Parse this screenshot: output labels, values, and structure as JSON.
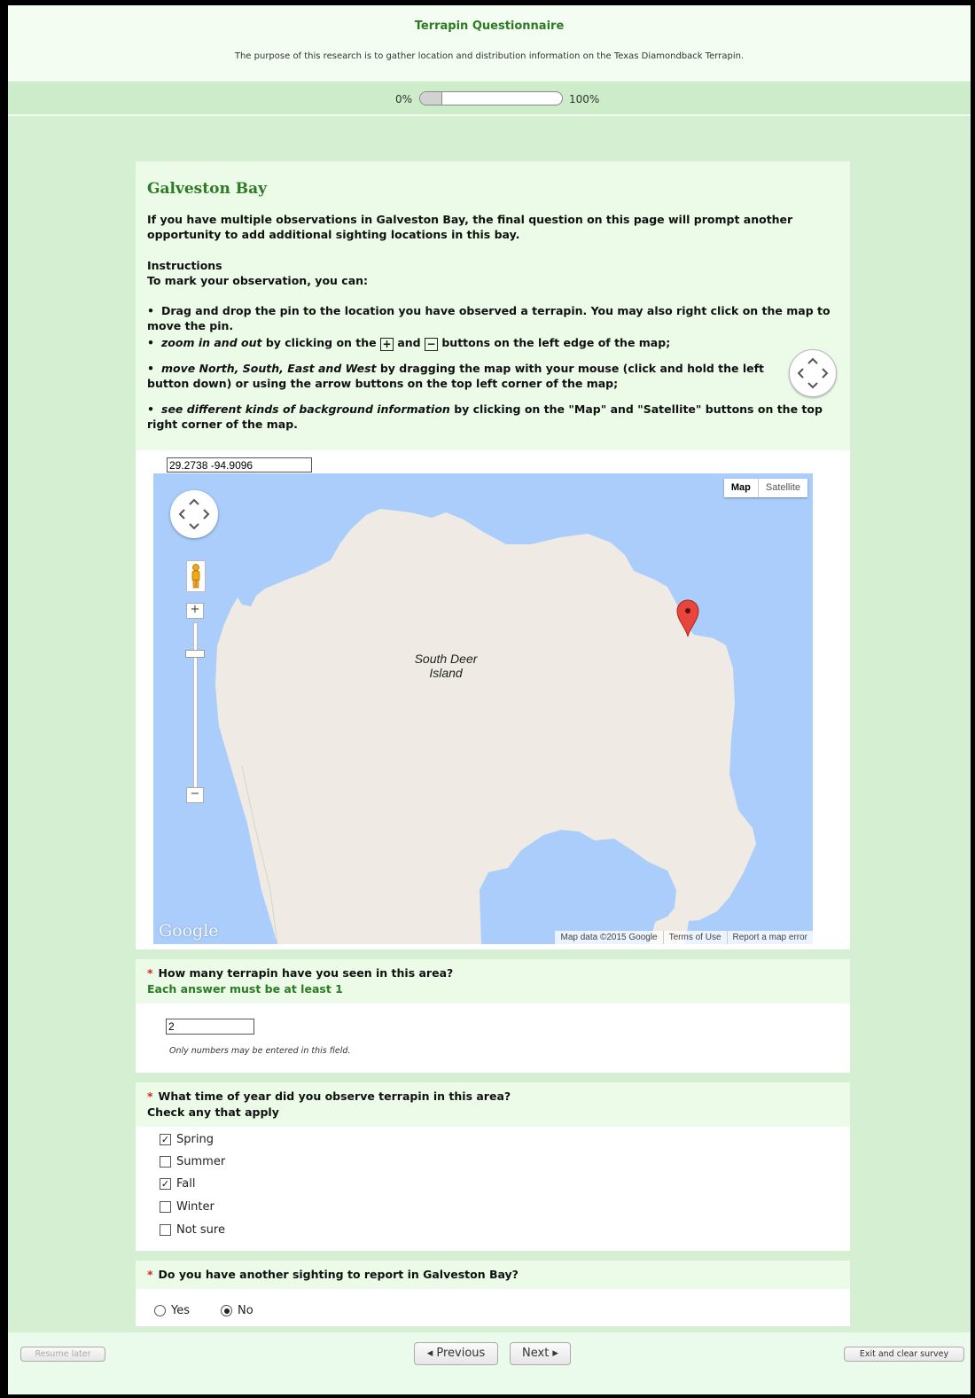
{
  "header": {
    "title": "Terrapin Questionnaire",
    "description": "The purpose of this research is to gather location and distribution information on the Texas Diamondback Terrapin."
  },
  "progress": {
    "min_label": "0%",
    "max_label": "100%",
    "value_fraction": 0.15
  },
  "section": {
    "title": "Galveston Bay",
    "intro": "If you have multiple observations in Galveston Bay, the final question on this page will prompt another opportunity to add additional sighting locations in this bay.",
    "instructions_heading": "Instructions",
    "instructions_lead": "To mark your observation, you can:",
    "bullets": {
      "b1": "Drag and drop the pin to the location you have observed a terrapin. You may also right click on the map to move the pin.",
      "b2_em": "zoom in and out",
      "b2_a": " by clicking on the ",
      "b2_b": " and ",
      "b2_c": " buttons on the left edge of the map;",
      "b3_em": "move North, South, East and West",
      "b3_rest": " by dragging the map with your mouse (click and hold the left button down) or using the arrow buttons on the top left corner of the map;",
      "b4_em": "see different kinds of background information",
      "b4_rest": " by clicking on the \"Map\" and \"Satellite\" buttons on the top right corner of the map."
    },
    "plus_glyph": "+",
    "minus_glyph": "−"
  },
  "map": {
    "coordinates": "29.2738 -94.9096",
    "map_type_map": "Map",
    "map_type_satellite": "Satellite",
    "place_label_line1": "South Deer",
    "place_label_line2": "Island",
    "logo": "Google",
    "attribution": "Map data ©2015 Google",
    "terms": "Terms of Use",
    "report": "Report a map error",
    "zoom_in": "+",
    "zoom_out": "−",
    "colors": {
      "water": "#abcdfc",
      "land": "#efebe4",
      "pin": "#e8453c"
    }
  },
  "q1": {
    "required_mark": "*",
    "question": "How many terrapin have you seen in this area?",
    "subtext": "Each answer must be at least 1",
    "value": "2",
    "hint": "Only numbers may be entered in this field."
  },
  "q2": {
    "required_mark": "*",
    "question": "What time of year did you observe terrapin in this area?",
    "subtext": "Check any that apply",
    "options": [
      {
        "label": "Spring",
        "checked": true
      },
      {
        "label": "Summer",
        "checked": false
      },
      {
        "label": "Fall",
        "checked": true
      },
      {
        "label": "Winter",
        "checked": false
      },
      {
        "label": "Not sure",
        "checked": false
      }
    ]
  },
  "q3": {
    "required_mark": "*",
    "question": "Do you have another sighting to report in Galveston Bay?",
    "yes_label": "Yes",
    "no_label": "No",
    "selected": "No"
  },
  "footer": {
    "resume_later": "Resume later",
    "previous": "◂ Previous",
    "next": "Next ▸",
    "exit": "Exit and clear survey"
  }
}
